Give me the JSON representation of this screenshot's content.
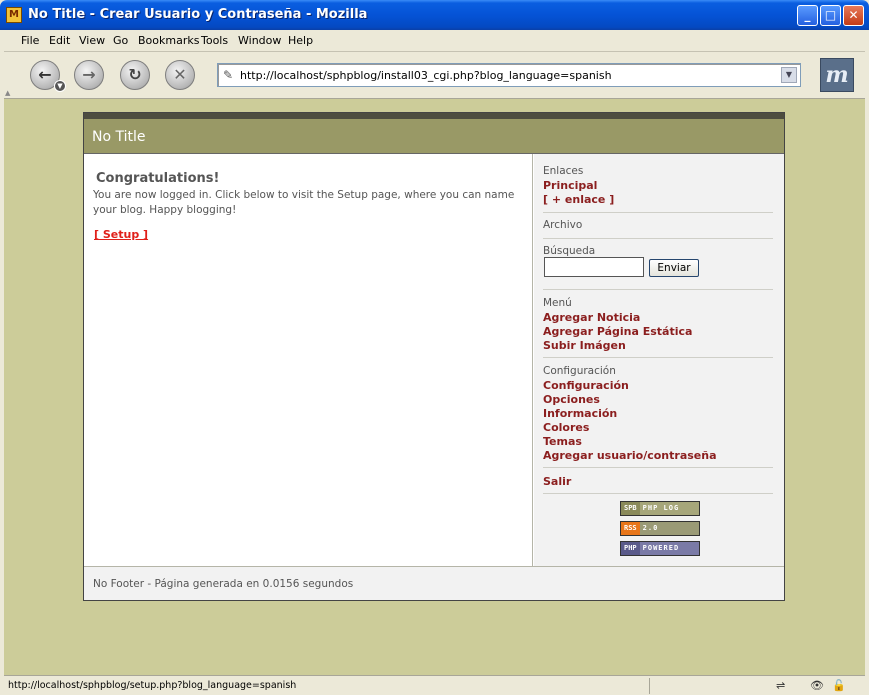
{
  "window": {
    "title": "No Title - Crear Usuario y Contraseña - Mozilla",
    "app_icon": "mozilla-icon",
    "controls": {
      "minimize": "_",
      "maximize": "□",
      "close": "✕"
    }
  },
  "menu": {
    "items": [
      "File",
      "Edit",
      "View",
      "Go",
      "Bookmarks",
      "Tools",
      "Window",
      "Help"
    ]
  },
  "toolbar": {
    "back_glyph": "←",
    "forward_glyph": "→",
    "reload_glyph": "↻",
    "stop_glyph": "✕",
    "url": "http://localhost/sphpblog/install03_cgi.php?blog_language=spanish",
    "logo": "m"
  },
  "blog": {
    "title": "No Title",
    "main": {
      "heading": "Congratulations!",
      "message": "You are now logged in. Click below to visit the Setup page, where you can name your blog. Happy blogging!",
      "setup_link": "[ Setup ]"
    },
    "sidebar": {
      "enlaces_title": "Enlaces",
      "principal": "Principal",
      "add_link": "[ + enlace ]",
      "archivo_title": "Archivo",
      "busqueda_title": "Búsqueda",
      "search_value": "",
      "enviar": "Enviar",
      "menu_title": "Menú",
      "menu_items": [
        "Agregar Noticia",
        "Agregar Página Estática",
        "Subir Imágen"
      ],
      "config_title": "Configuración",
      "config_items": [
        "Configuración",
        "Opciones",
        "Información",
        "Colores",
        "Temas",
        "Agregar usuario/contraseña"
      ],
      "salir": "Salir",
      "badges": [
        {
          "left": "SPB",
          "right": "PHP LOG",
          "lcolor": "#8a8a5a",
          "rcolor": "#a6a67a"
        },
        {
          "left": "RSS",
          "right": "2.0",
          "lcolor": "#e8761a",
          "rcolor": "#9a9a76"
        },
        {
          "left": "PHP",
          "right": "POWERED",
          "lcolor": "#5a5a8a",
          "rcolor": "#7a7aa6"
        }
      ]
    },
    "footer": "No Footer - Página generada en 0.0156 segundos"
  },
  "status": {
    "text": "http://localhost/sphpblog/setup.php?blog_language=spanish"
  }
}
